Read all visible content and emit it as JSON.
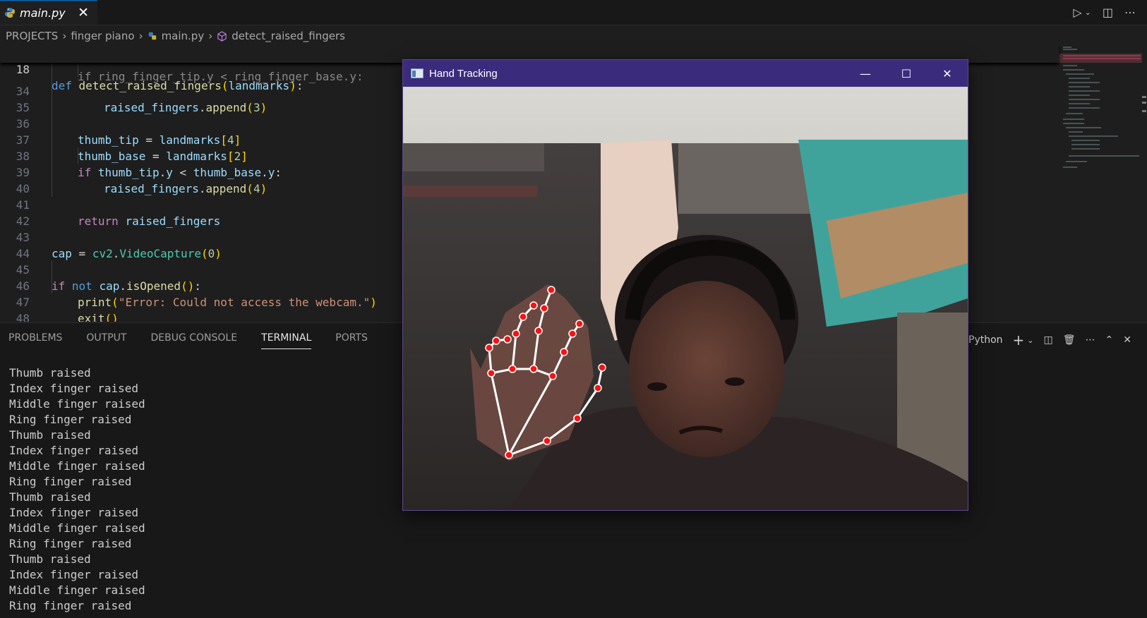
{
  "tab": {
    "filename": "main.py"
  },
  "breadcrumb": [
    "PROJECTS",
    "finger piano",
    "main.py",
    "detect_raised_fingers"
  ],
  "editor": {
    "sticky": {
      "line": "18",
      "kw": "def",
      "fn": "detect_raised_fingers",
      "param": "landmarks"
    },
    "partial_line": "if ring_finger_tip.y < ring_finger_base.y:",
    "lines": [
      {
        "n": "34"
      },
      {
        "n": "35"
      },
      {
        "n": "36"
      },
      {
        "n": "37"
      },
      {
        "n": "38"
      },
      {
        "n": "39"
      },
      {
        "n": "40"
      },
      {
        "n": "41"
      },
      {
        "n": "42"
      },
      {
        "n": "43"
      },
      {
        "n": "44"
      },
      {
        "n": "45"
      },
      {
        "n": "46"
      },
      {
        "n": "47"
      },
      {
        "n": "48"
      }
    ],
    "tokens": {
      "raised_fingers": "raised_fingers",
      "append": "append",
      "thumb_tip": "thumb_tip",
      "thumb_base": "thumb_base",
      "landmarks": "landmarks",
      "cap": "cap",
      "cv2": "cv2",
      "VideoCapture": "VideoCapture",
      "isOpened": "isOpened",
      "print": "print",
      "exit": "exit",
      "y": "y",
      "if": "if",
      "not": "not",
      "return": "return",
      "error_str": "\"Error: Could not access the webcam.\"",
      "n0": "0",
      "n2": "2",
      "n3": "3",
      "n4": "4"
    }
  },
  "panel": {
    "tabs": [
      "PROBLEMS",
      "OUTPUT",
      "DEBUG CONSOLE",
      "TERMINAL",
      "PORTS"
    ],
    "active_tab": "TERMINAL",
    "shell": "Python",
    "terminal_lines": [
      "Thumb raised",
      "Index finger raised",
      "Middle finger raised",
      "Ring finger raised",
      "Thumb raised",
      "Index finger raised",
      "Middle finger raised",
      "Ring finger raised",
      "Thumb raised",
      "Index finger raised",
      "Middle finger raised",
      "Ring finger raised",
      "Thumb raised",
      "Index finger raised",
      "Middle finger raised",
      "Ring finger raised"
    ]
  },
  "hand_window": {
    "title": "Hand Tracking",
    "minimize_glyph": "—",
    "maximize_glyph": "☐",
    "close_glyph": "✕"
  },
  "colors": {
    "accent": "#0078d4",
    "window_titlebar": "#3b2b7c",
    "landmark": "#ff1010",
    "connection": "#ffffff"
  }
}
